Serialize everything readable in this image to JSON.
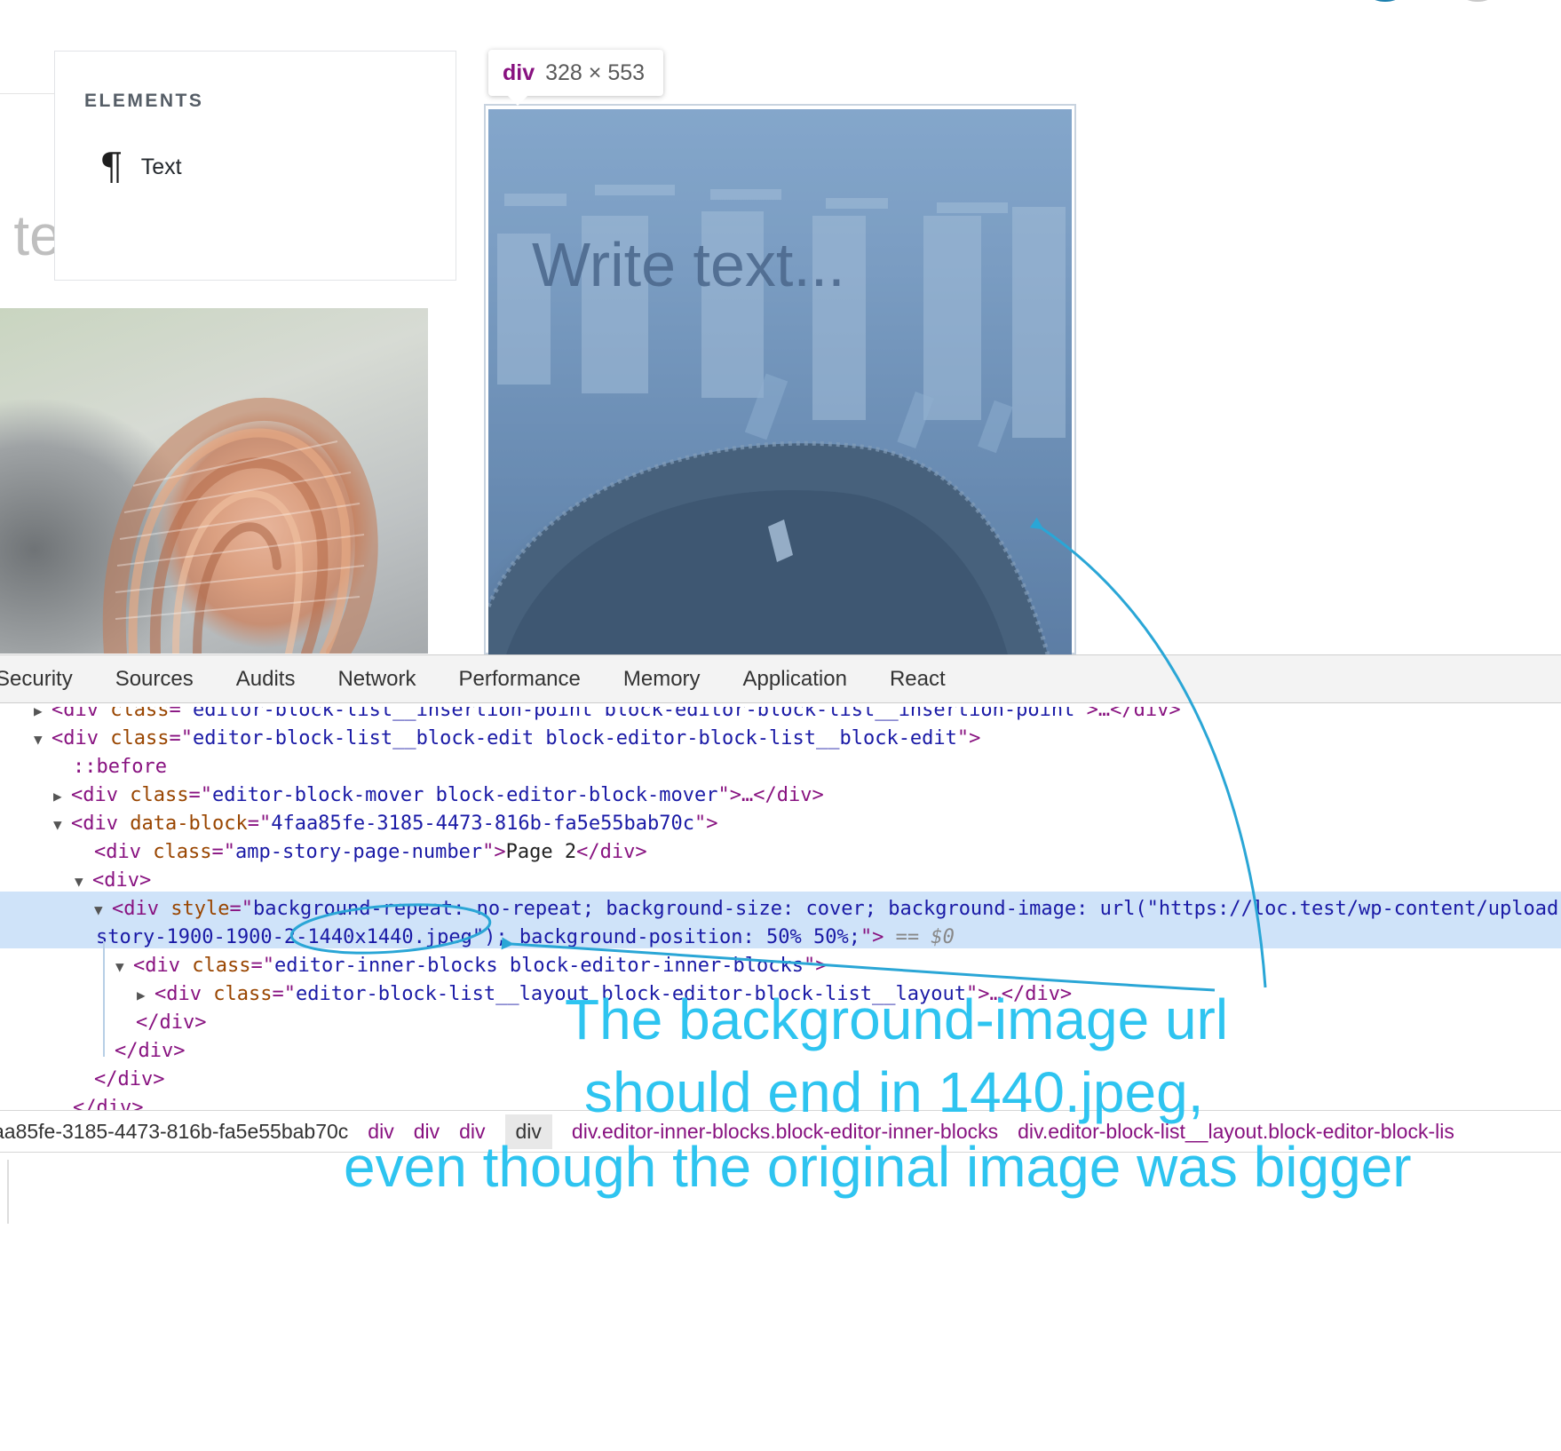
{
  "editor": {
    "background_text": "e te",
    "inserter": {
      "heading": "ELEMENTS",
      "items": [
        {
          "label": "Text",
          "icon": "pilcrow-icon"
        }
      ]
    },
    "tooltip": {
      "tag": "div",
      "size": "328 × 553"
    },
    "page_placeholder": "Write text..."
  },
  "devtools": {
    "tabs": [
      "Security",
      "Sources",
      "Audits",
      "Network",
      "Performance",
      "Memory",
      "Application",
      "React"
    ],
    "lines": {
      "l0": {
        "tag": "div",
        "attr": "class",
        "value": "editor-block-list__insertion-point block-editor-block-list__insertion-point",
        "tail": ">…</div>"
      },
      "l1": {
        "tag": "div",
        "attr": "class",
        "value": "editor-block-list__block-edit block-editor-block-list__block-edit"
      },
      "l2": {
        "text": "::before"
      },
      "l3": {
        "tag": "div",
        "attr": "class",
        "value": "editor-block-mover block-editor-block-mover",
        "tail": ">…</div>"
      },
      "l4": {
        "tag": "div",
        "attr": "data-block",
        "value": "4faa85fe-3185-4473-816b-fa5e55bab70c"
      },
      "l5": {
        "tag": "div",
        "attr": "class",
        "value": "amp-story-page-number",
        "content": "Page 2",
        "close": "</div>"
      },
      "l6": {
        "tag": "div"
      },
      "l7": {
        "tag": "div",
        "attr": "style",
        "value": "background-repeat: no-repeat; background-size: cover; background-image: url(\"https://loc.test/wp-content/upload"
      },
      "l8": {
        "value": "story-1900-1900-2-1440x1440.jpeg\"); background-position: 50% 50%;",
        "tail": "\">",
        "eq": " == $0"
      },
      "l9": {
        "tag": "div",
        "attr": "class",
        "value": "editor-inner-blocks block-editor-inner-blocks"
      },
      "l10": {
        "tag": "div",
        "attr": "class",
        "value": "editor-block-list__layout block-editor-block-list__layout",
        "tail": ">…</div>"
      },
      "l11": {
        "text": "</div>"
      },
      "l12": {
        "text": "</div>"
      },
      "l13": {
        "text": "</div>"
      },
      "l14": {
        "text": "</div>"
      }
    },
    "breadcrumbs": [
      "aa85fe-3185-4473-816b-fa5e55bab70c",
      "div",
      "div",
      "div",
      "div",
      "div.editor-inner-blocks.block-editor-inner-blocks",
      "div.editor-block-list__layout.block-editor-block-lis"
    ]
  },
  "annotation": {
    "line1": "The background-image url",
    "line2": "should end in 1440.jpeg,",
    "line3": "even though the original image was bigger",
    "color": "#2ec4f0"
  }
}
